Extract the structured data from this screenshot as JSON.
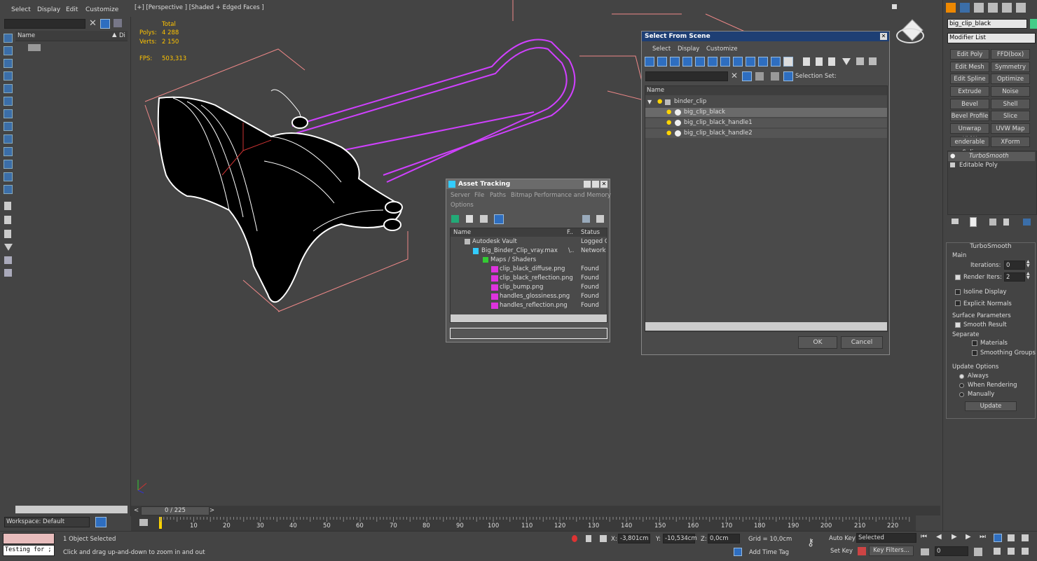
{
  "menu": {
    "select": "Select",
    "display": "Display",
    "edit": "Edit",
    "customize": "Customize"
  },
  "scene_explorer": {
    "col_name": "Name",
    "col_di": "Di"
  },
  "viewport": {
    "label": "[+] [Perspective ] [Shaded + Edged Faces ]",
    "stats_total": "Total",
    "polys_label": "Polys:",
    "polys_value": "4 288",
    "verts_label": "Verts:",
    "verts_value": "2 150",
    "fps_label": "FPS:",
    "fps_value": "503,313"
  },
  "select_from_scene": {
    "title": "Select From Scene",
    "menu": [
      "Select",
      "Display",
      "Customize"
    ],
    "selection_set_label": "Selection Set:",
    "col_name": "Name",
    "items": [
      {
        "label": "binder_clip",
        "indent": 0
      },
      {
        "label": "big_clip_black",
        "indent": 1,
        "selected": true
      },
      {
        "label": "big_clip_black_handle1",
        "indent": 1
      },
      {
        "label": "big_clip_black_handle2",
        "indent": 1
      }
    ],
    "ok": "OK",
    "cancel": "Cancel"
  },
  "asset_tracking": {
    "title": "Asset Tracking",
    "menu": [
      "Server",
      "File",
      "Paths",
      "Bitmap Performance and Memory",
      "Options"
    ],
    "col_name": "Name",
    "col_f": "F..",
    "col_status": "Status",
    "rows": [
      {
        "name": "Autodesk Vault",
        "f": "",
        "status": "Logged Ou"
      },
      {
        "name": "Big_Binder_Clip_vray.max",
        "f": "\\..",
        "status": "Network P"
      },
      {
        "name": "Maps / Shaders",
        "f": "",
        "status": ""
      },
      {
        "name": "clip_black_diffuse.png",
        "f": "",
        "status": "Found"
      },
      {
        "name": "clip_black_reflection.png",
        "f": "",
        "status": "Found"
      },
      {
        "name": "clip_bump.png",
        "f": "",
        "status": "Found"
      },
      {
        "name": "handles_glossiness.png",
        "f": "",
        "status": "Found"
      },
      {
        "name": "handles_reflection.png",
        "f": "",
        "status": "Found"
      }
    ]
  },
  "command_panel": {
    "object_name": "big_clip_black",
    "modifier_list": "Modifier List",
    "modifiers": [
      "Edit Poly",
      "FFD(box)",
      "Edit Mesh",
      "Symmetry",
      "Edit Spline",
      "Optimize",
      "Extrude",
      "Noise",
      "Bevel",
      "Shell",
      "Bevel Profile",
      "Slice",
      "Unwrap UVW",
      "UVW Map",
      "enderable Splin",
      "XForm"
    ],
    "stack": [
      "TurboSmooth",
      "Editable Poly"
    ],
    "rollout_title": "TurboSmooth",
    "main_label": "Main",
    "iterations_label": "Iterations:",
    "iterations_value": "0",
    "render_iters_label": "Render Iters:",
    "render_iters_value": "2",
    "isoline_display": "Isoline Display",
    "explicit_normals": "Explicit Normals",
    "surface_parameters": "Surface Parameters",
    "smooth_result": "Smooth Result",
    "separate": "Separate",
    "materials": "Materials",
    "smoothing_groups": "Smoothing Groups",
    "update_options": "Update Options",
    "always": "Always",
    "when_rendering": "When Rendering",
    "manually": "Manually",
    "update": "Update"
  },
  "timeline": {
    "frame": "0 / 225",
    "ticks": [
      "10",
      "20",
      "30",
      "40",
      "50",
      "60",
      "70",
      "80",
      "90",
      "100",
      "110",
      "120",
      "130",
      "140",
      "150",
      "160",
      "170",
      "180",
      "190",
      "200",
      "210",
      "220"
    ]
  },
  "workspace": "Workspace: Default",
  "status": {
    "maxscript": "Testing for ;",
    "selected": "1 Object Selected",
    "prompt": "Click and drag up-and-down to zoom in and out",
    "x_label": "X:",
    "x_value": "-3,801cm",
    "y_label": "Y:",
    "y_value": "-10,534cm",
    "z_label": "Z:",
    "z_value": "0,0cm",
    "grid": "Grid = 10,0cm",
    "add_time_tag": "Add Time Tag",
    "auto_key": "Auto Key",
    "selected_dropdown": "Selected",
    "set_key": "Set Key",
    "key_filters": "Key Filters...",
    "frame_field": "0"
  }
}
